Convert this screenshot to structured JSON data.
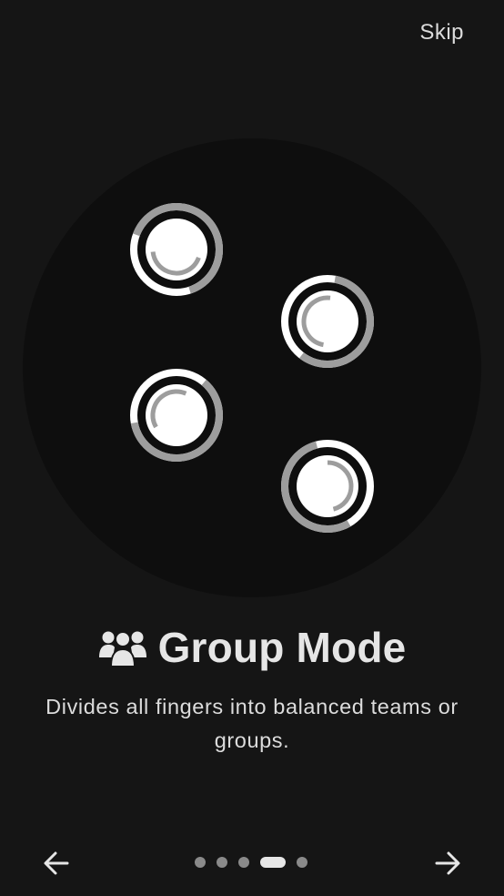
{
  "header": {
    "skip_label": "Skip"
  },
  "illustration": {
    "touch_points": 4
  },
  "content": {
    "title": "Group Mode",
    "title_icon": "group-icon",
    "description": "Divides all fingers into balanced teams or groups."
  },
  "pager": {
    "total_pages": 5,
    "current_page": 4,
    "prev_icon": "arrow-left-icon",
    "next_icon": "arrow-right-icon"
  },
  "colors": {
    "background": "#151515",
    "disc": "#0e0e0e",
    "text": "#e6e6e6",
    "dot_inactive": "#8a8a8a",
    "dot_active": "#e6e6e6"
  }
}
